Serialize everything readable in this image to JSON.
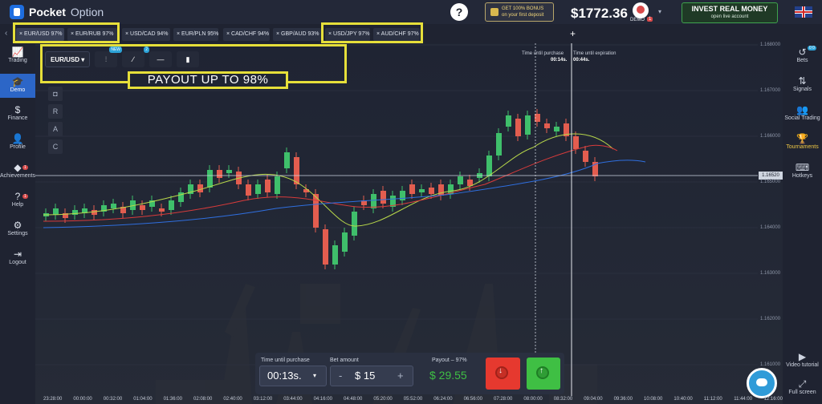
{
  "brand": {
    "name_bold": "Pocket",
    "name_thin": "Option"
  },
  "header": {
    "help": "?",
    "bonus_line1": "GET 100% BONUS",
    "bonus_line2": "on your first deposit",
    "balance": "$1772.36",
    "account_type": "DEMO",
    "notif_count": "1",
    "invest_line1": "INVEST REAL MONEY",
    "invest_line2": "open live account"
  },
  "tabs": [
    {
      "label": "EUR/USD 97%"
    },
    {
      "label": "EUR/RUB 97%"
    },
    {
      "label": "USD/CAD 94%"
    },
    {
      "label": "EUR/PLN 95%"
    },
    {
      "label": "CAD/CHF 94%"
    },
    {
      "label": "GBP/AUD 93%"
    },
    {
      "label": "USD/JPY 97%"
    },
    {
      "label": "AUD/CHF 97%"
    }
  ],
  "sidebar_left": [
    {
      "label": "Trading",
      "icon": "chart-line-icon"
    },
    {
      "label": "Demo",
      "icon": "graduation-cap-icon"
    },
    {
      "label": "Finance",
      "icon": "dollar-icon"
    },
    {
      "label": "Profile",
      "icon": "user-icon"
    },
    {
      "label": "Achievements",
      "icon": "diamond-icon"
    },
    {
      "label": "Help",
      "icon": "help-icon"
    },
    {
      "label": "Settings",
      "icon": "gear-icon"
    },
    {
      "label": "Logout",
      "icon": "logout-icon"
    }
  ],
  "sidebar_left_badges": {
    "achievements": "1",
    "help": "1"
  },
  "sidebar_right": [
    {
      "label": "Bets",
      "icon": "history-icon"
    },
    {
      "label": "Signals",
      "icon": "signals-icon"
    },
    {
      "label": "Social Trading",
      "icon": "social-icon"
    },
    {
      "label": "Tournaments",
      "icon": "trophy-icon"
    },
    {
      "label": "Hotkeys",
      "icon": "keyboard-icon"
    },
    {
      "label": "Video tutorial",
      "icon": "video-icon"
    },
    {
      "label": "Full screen",
      "icon": "fullscreen-icon"
    }
  ],
  "sidebar_right_badges": {
    "bets": "0 0"
  },
  "chart_toolbar": {
    "pair": "EUR/USD",
    "indicator_badge": "NEW",
    "drawing_badge": "2"
  },
  "overlay": {
    "payout_text": "PAYOUT UP TO 98%"
  },
  "left_buttons": [
    "R",
    "A",
    "C"
  ],
  "timers": {
    "purchase_label": "Time until purchase",
    "purchase_value": "00:14s.",
    "expiration_label": "Time until expiration",
    "expiration_value": "00:44s."
  },
  "price_tag": "1.16520",
  "trade_panel": {
    "time_label": "Time until purchase",
    "time_value": "00:13s.",
    "amount_label": "Bet amount",
    "amount_minus": "-",
    "amount_value": "$ 15",
    "amount_plus": "+",
    "payout_label": "Payout – 97%",
    "payout_value": "$ 29.55"
  },
  "y_axis_labels": [
    "1.168000",
    "1.167000",
    "1.166000",
    "1.165000",
    "1.164000",
    "1.163000",
    "1.162000",
    "1.161000"
  ],
  "x_axis_labels": [
    "23:28:00",
    "00:00:00",
    "00:32:00",
    "01:04:00",
    "01:36:00",
    "02:08:00",
    "02:40:00",
    "03:12:00",
    "03:44:00",
    "04:16:00",
    "04:48:00",
    "05:20:00",
    "05:52:00",
    "06:24:00",
    "06:56:00",
    "07:28:00",
    "08:00:00",
    "08:32:00",
    "09:04:00",
    "09:36:00",
    "10:08:00",
    "10:40:00",
    "11:12:00",
    "11:44:00",
    "12:16:00"
  ],
  "colors": {
    "up": "#3fbf6b",
    "down": "#e35d4f",
    "highlight": "#e6df3a",
    "accent": "#2c66c7"
  }
}
